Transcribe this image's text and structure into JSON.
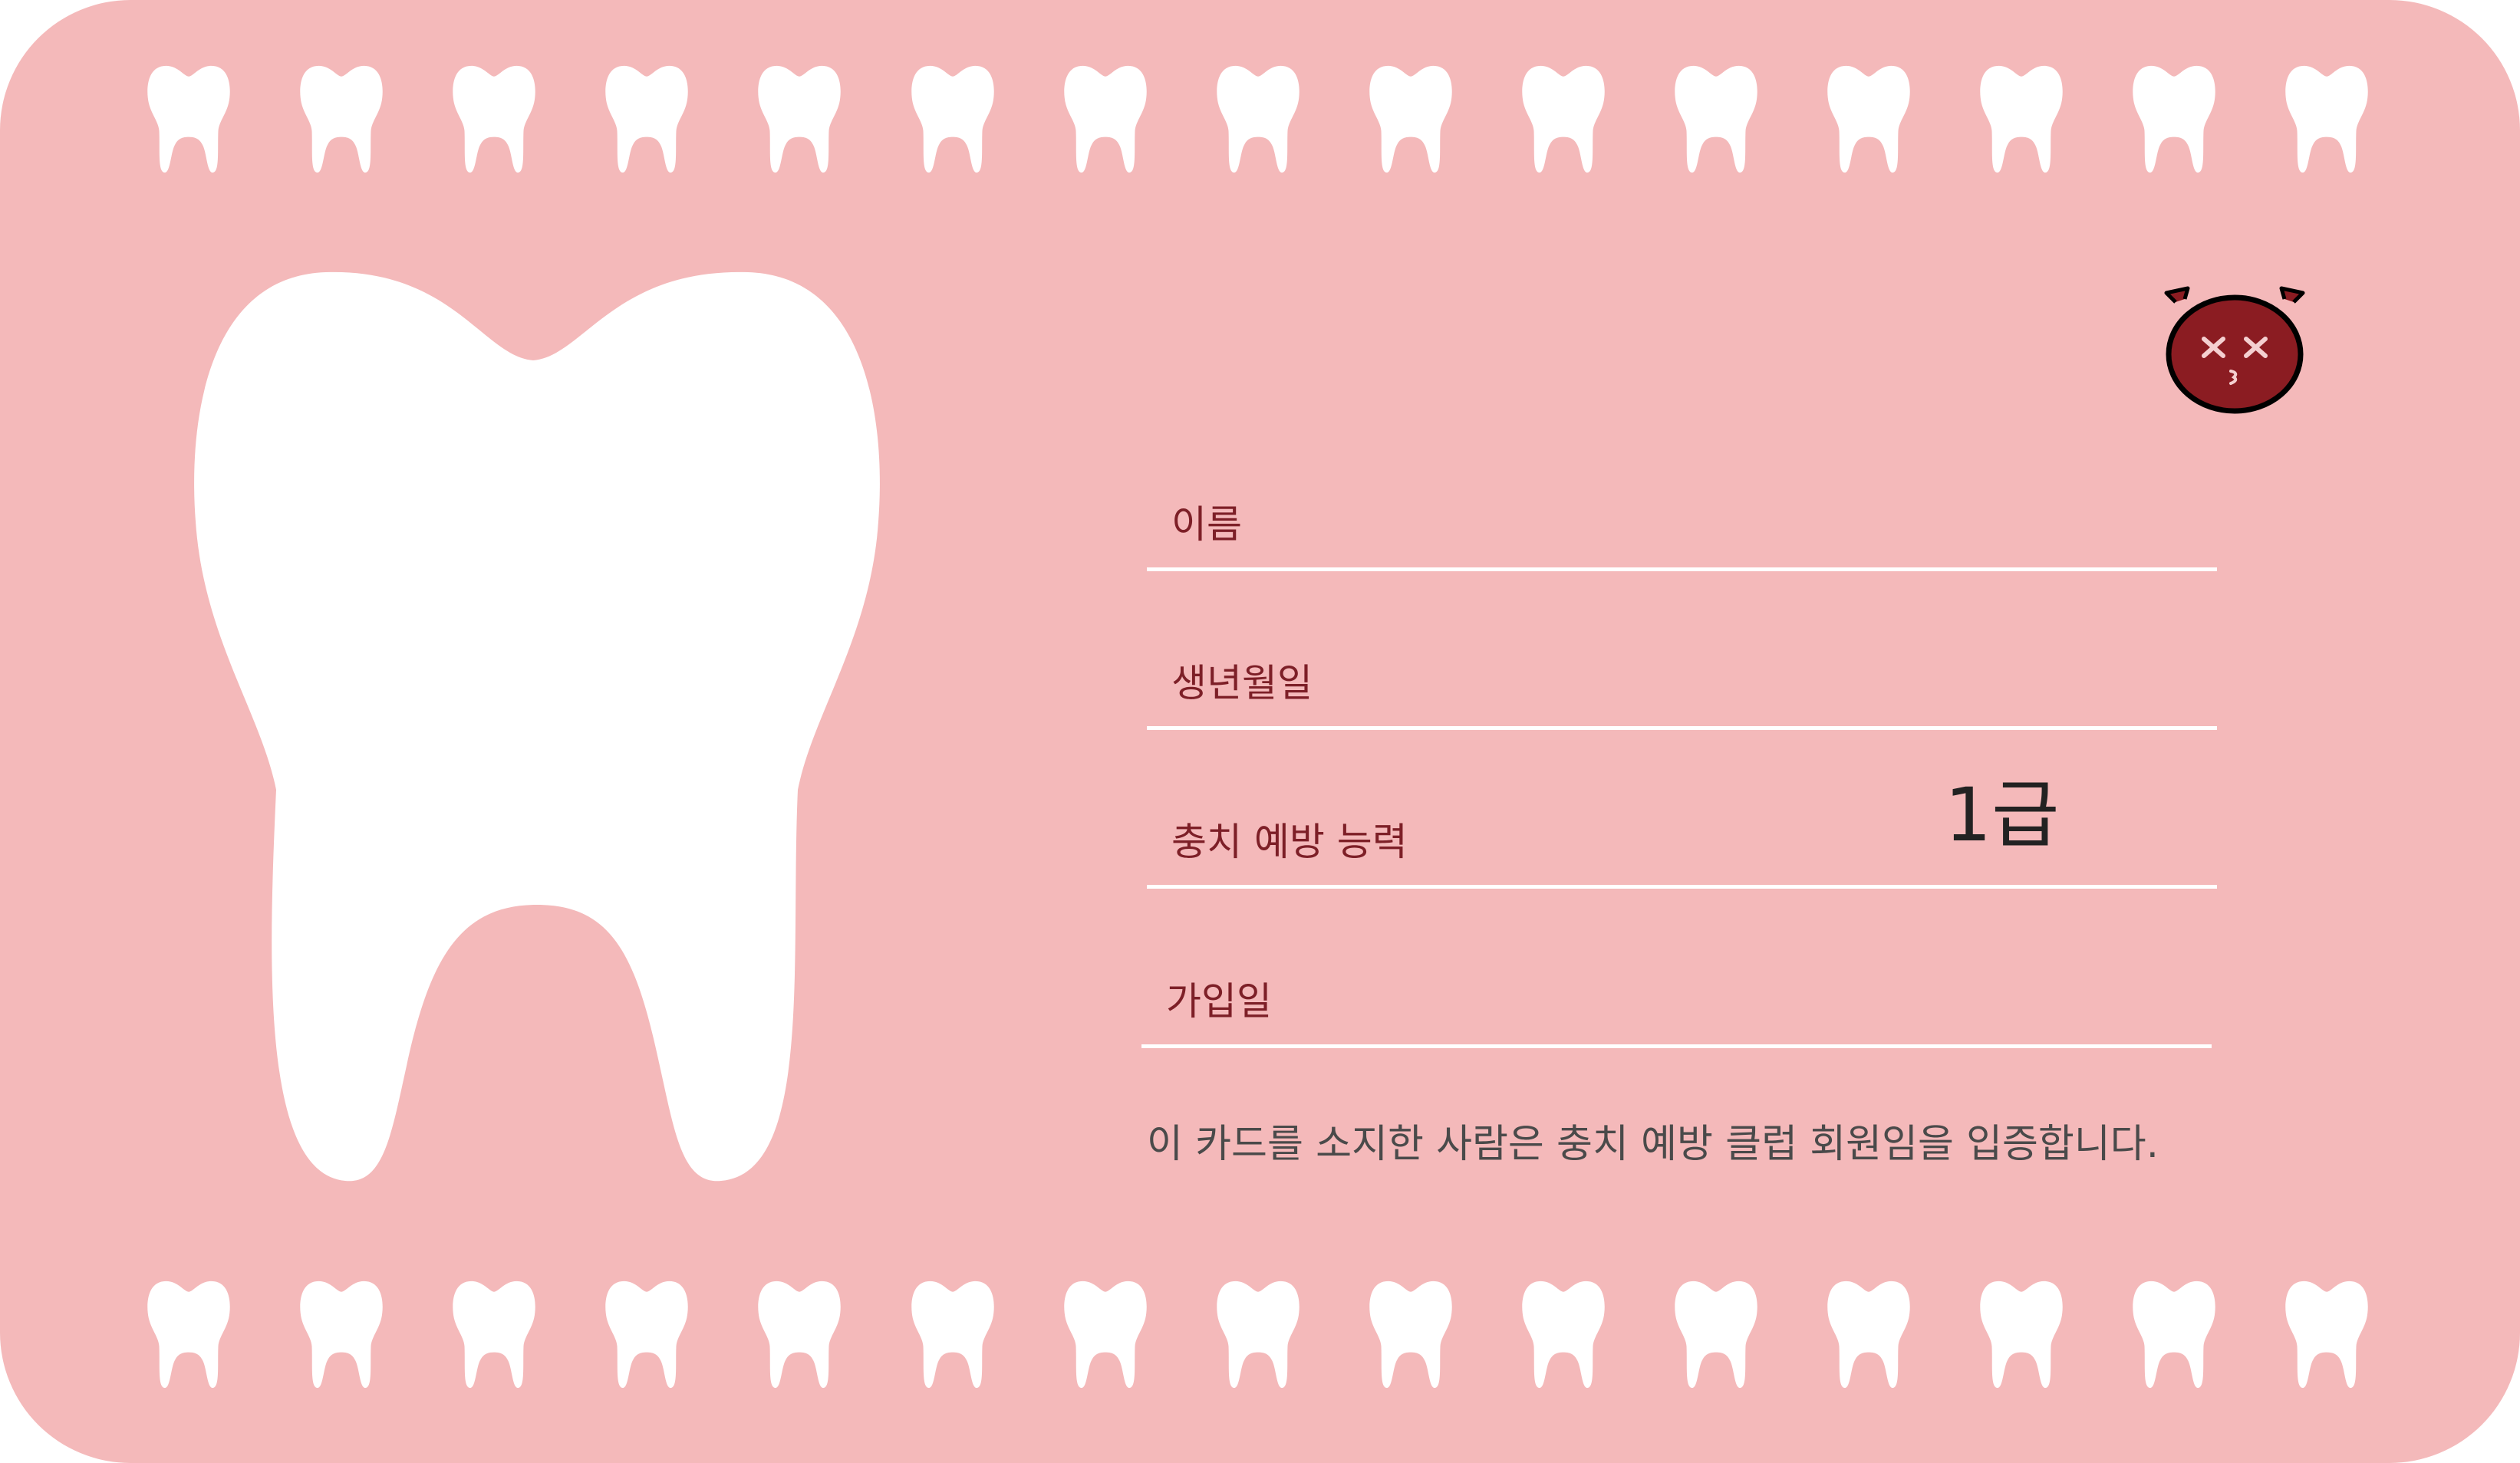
{
  "card": {
    "background_color": "#f4b9ba",
    "tooth_color": "#ffffff"
  },
  "decoration": {
    "border_tooth_icon": "tooth-icon",
    "main_tooth_icon": "large-tooth-illustration",
    "mascot_icon": "devil-face-icon",
    "mascot_color": "#8b1c22"
  },
  "fields": [
    {
      "label": "이름",
      "value": ""
    },
    {
      "label": "생년월일",
      "value": ""
    },
    {
      "label": "충치 예방 능력",
      "value": "1급"
    },
    {
      "label": "가입일",
      "value": ""
    }
  ],
  "notice": "이 카드를 소지한 사람은 충치 예방 클럽 회원임을 입증합니다."
}
